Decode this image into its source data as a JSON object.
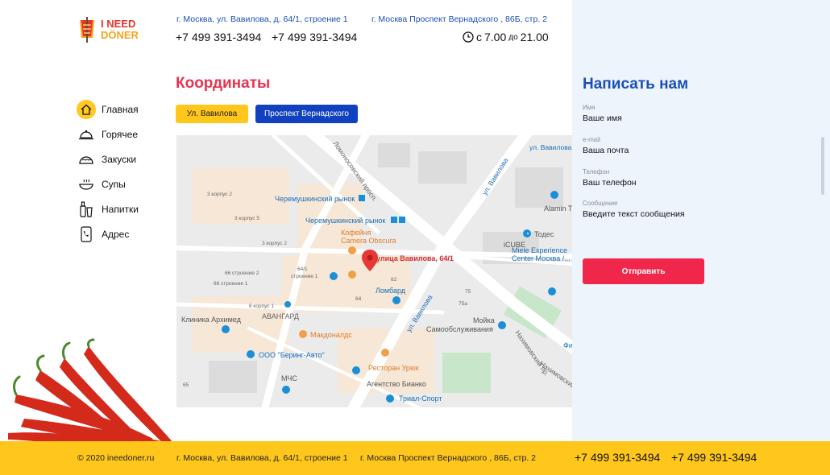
{
  "brand": {
    "line1": "I NEED",
    "line2": "DÖNER",
    "icon": "doner-logo-icon"
  },
  "header": {
    "address1": "г. Москва, ул. Вавилова, д. 64/1, строение 1",
    "address2": "г. Москва Проспект Вернадского , 86Б, стр. 2",
    "phone1": "+7 499 391-3494",
    "phone2": "+7 499 391-3494",
    "hours_from_prefix": "с",
    "hours_from": "7.00",
    "hours_to_prefix": "до",
    "hours_to": "21.00",
    "clock_icon": "clock-icon"
  },
  "nav": {
    "items": [
      {
        "label": "Главная",
        "icon": "home-icon",
        "active": true
      },
      {
        "label": "Горячее",
        "icon": "cloche-icon",
        "active": false
      },
      {
        "label": "Закуски",
        "icon": "taco-icon",
        "active": false
      },
      {
        "label": "Супы",
        "icon": "soup-bowl-icon",
        "active": false
      },
      {
        "label": "Напитки",
        "icon": "drinks-icon",
        "active": false
      },
      {
        "label": "Адрес",
        "icon": "phone-address-icon",
        "active": false
      }
    ]
  },
  "main": {
    "title": "Координаты",
    "tabs": [
      {
        "label": "Ул. Вавилова",
        "selected": false
      },
      {
        "label": "Проспект Вернадского",
        "selected": true
      }
    ]
  },
  "map": {
    "labels": [
      "Черемушкинский рынок",
      "Черемушкинский рынок",
      "Кофейня",
      "Camera Obscura",
      "улица Вавилова, 64/1",
      "Ломбард",
      "Макдоналдс",
      "Клиника Архимед",
      "АВАНГАРД",
      "ООО \"Беринг-Авто\"",
      "Ресторан Урюк",
      "МЧС",
      "Агентство Бианко",
      "Триал-Спорт",
      "Мойка",
      "Самообслуживания",
      "iCUBE",
      "Тодес",
      "Miele Experience",
      "Center Москва /...",
      "Alamin T",
      "ул. Вавилова",
      "ул. Вавилова",
      "ул. Вавилова",
      "Ломоносовский просп.",
      "Нахимовский пр.",
      "Нахимовский",
      "3 корпус 2",
      "3 корпус 5",
      "3 корпус 2",
      "64/1",
      "строение 1",
      "66 строение 2",
      "66 строение 1",
      "6 корпус 1",
      "62",
      "64",
      "65",
      "75",
      "75a",
      "Фи"
    ],
    "pin_color": "#e53935"
  },
  "contact": {
    "title": "Написать нам",
    "fields": [
      {
        "label": "Имя",
        "value": "Ваше имя"
      },
      {
        "label": "e-mail",
        "value": "Ваша почта"
      },
      {
        "label": "Телефон",
        "value": "Ваш телефон"
      },
      {
        "label": "Сообщение",
        "value": "Введите текст сообщения"
      }
    ],
    "submit": "Отправить"
  },
  "footer": {
    "copyright": "© 2020 ineedoner.ru",
    "address1": "г. Москва, ул. Вавилова, д. 64/1, строение 1",
    "address2": "г. Москва Проспект Вернадского , 86Б, стр. 2",
    "phone1": "+7 499 391-3494",
    "phone2": "+7 499 391-3494"
  },
  "colors": {
    "accent_yellow": "#ffc61c",
    "accent_blue": "#1241c0",
    "title_red": "#e8334f",
    "button_red": "#f0264a",
    "panel_bg": "#eef4fb"
  }
}
